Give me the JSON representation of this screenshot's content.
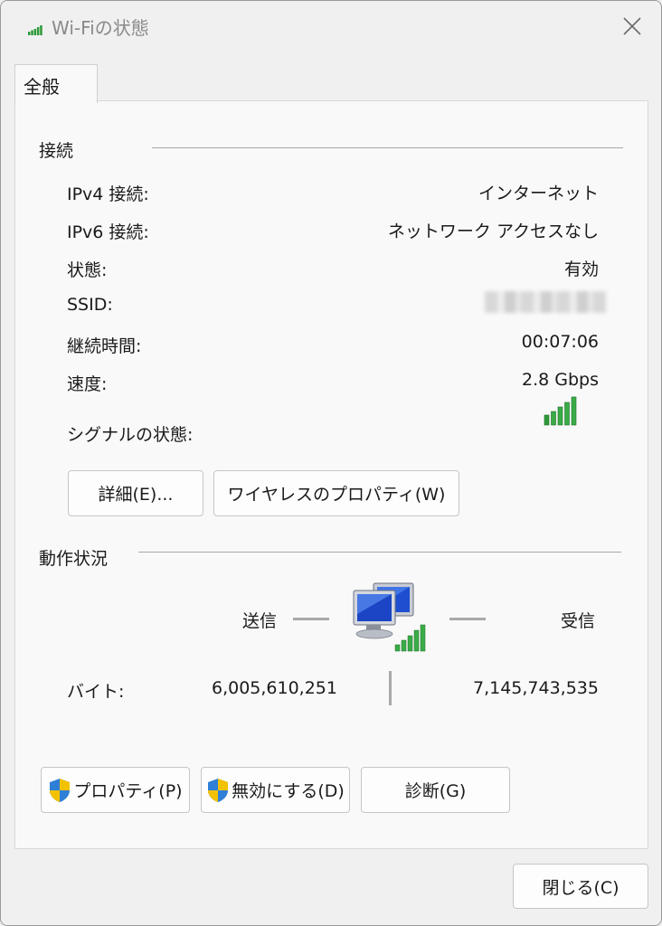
{
  "window": {
    "title": "Wi-Fiの状態",
    "close_icon": "close-icon"
  },
  "tabs": [
    {
      "label": "全般",
      "selected": true
    }
  ],
  "connection": {
    "section_title": "接続",
    "rows": [
      {
        "label": "IPv4 接続:",
        "value": "インターネット"
      },
      {
        "label": "IPv6 接続:",
        "value": "ネットワーク アクセスなし"
      },
      {
        "label": "状態:",
        "value": "有効"
      },
      {
        "label": "SSID:",
        "value": ""
      },
      {
        "label": "継続時間:",
        "value": "00:07:06"
      },
      {
        "label": "速度:",
        "value": "2.8 Gbps"
      }
    ],
    "signal_label": "シグナルの状態:",
    "signal_bars": 5,
    "signal_bars_total": 5,
    "signal_color": "#2e9a3a",
    "details_button": "詳細(E)...",
    "wireless_props_button": "ワイヤレスのプロパティ(W)"
  },
  "activity": {
    "section_title": "動作状況",
    "sent_label": "送信",
    "received_label": "受信",
    "bytes_label": "バイト:",
    "bytes_sent": "6,005,610,251",
    "bytes_received": "7,145,743,535",
    "network_icon": "network-computers-icon"
  },
  "buttons": {
    "properties": "プロパティ(P)",
    "disable": "無効にする(D)",
    "diagnose": "診断(G)",
    "close": "閉じる(C)"
  },
  "colors": {
    "accent_green": "#2e9a3a",
    "shield_blue": "#2f7fd6",
    "shield_yellow": "#f2c200"
  }
}
